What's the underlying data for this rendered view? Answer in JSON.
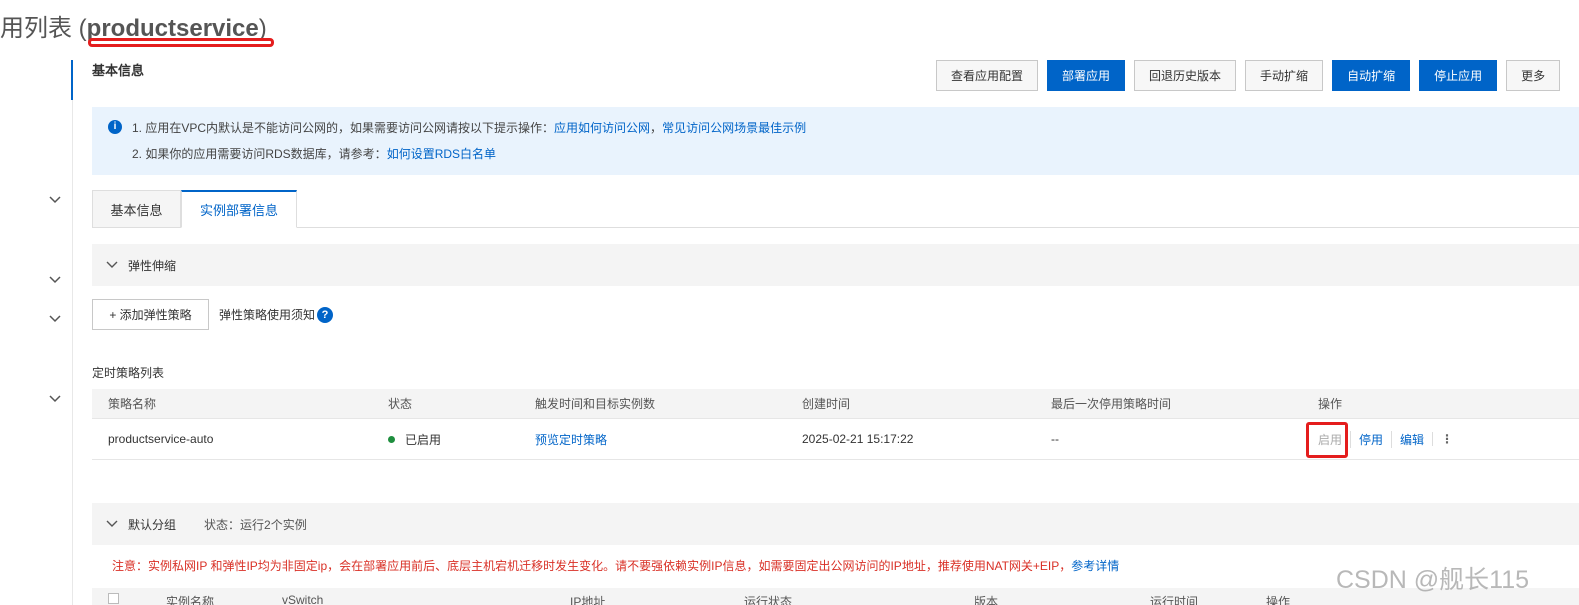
{
  "page": {
    "title_prefix": "用列表 (",
    "app_name": "productservice",
    "title_suffix": ")"
  },
  "section_title": "基本信息",
  "toolbar": {
    "view_config": "查看应用配置",
    "deploy": "部署应用",
    "rollback": "回退历史版本",
    "manual_scale": "手动扩缩",
    "auto_scale": "自动扩缩",
    "stop": "停止应用",
    "more": "更多"
  },
  "notice": {
    "line1_text": "1. 应用在VPC内默认是不能访问公网的，如果需要访问公网请按以下提示操作：",
    "line1_link1": "应用如何访问公网",
    "line1_sep": "，",
    "line1_link2": "常见访问公网场景最佳示例",
    "line2_text": "2. 如果你的应用需要访问RDS数据库，请参考：",
    "line2_link": "如何设置RDS白名单"
  },
  "tabs": [
    "基本信息",
    "实例部署信息"
  ],
  "elastic": {
    "header": "弹性伸缩",
    "add_button": "+ 添加弹性策略",
    "help_text": "弹性策略使用须知",
    "help_icon": "?",
    "list_title": "定时策略列表",
    "columns": [
      "策略名称",
      "状态",
      "触发时间和目标实例数",
      "创建时间",
      "最后一次停用策略时间",
      "操作"
    ],
    "rows": [
      {
        "name": "productservice-auto",
        "status": "已启用",
        "trigger": "预览定时策略",
        "created": "2025-02-21 15:17:22",
        "last_disabled": "--",
        "op_enable": "启用",
        "op_disable": "停用",
        "op_edit": "编辑",
        "op_more": "⋮"
      }
    ]
  },
  "default_group": {
    "header": "默认分组",
    "status": "状态：运行2个实例",
    "warning_text": "注意：实例私网IP 和弹性IP均为非固定ip，会在部署应用前后、底层主机宕机迁移时发生变化。请不要强依赖实例IP信息，如需要固定出公网访问的IP地址，推荐使用NAT网关+EIP，",
    "warning_link": "参考详情",
    "columns": [
      "实例名称",
      "vSwitch",
      "IP地址",
      "运行状态",
      "版本",
      "运行时间",
      "操作"
    ]
  },
  "watermark": "CSDN @舰长115",
  "colors": {
    "primary": "#0064c8",
    "highlight": "#e41d1d",
    "running": "#1e8e3e",
    "warning": "#d93026"
  }
}
